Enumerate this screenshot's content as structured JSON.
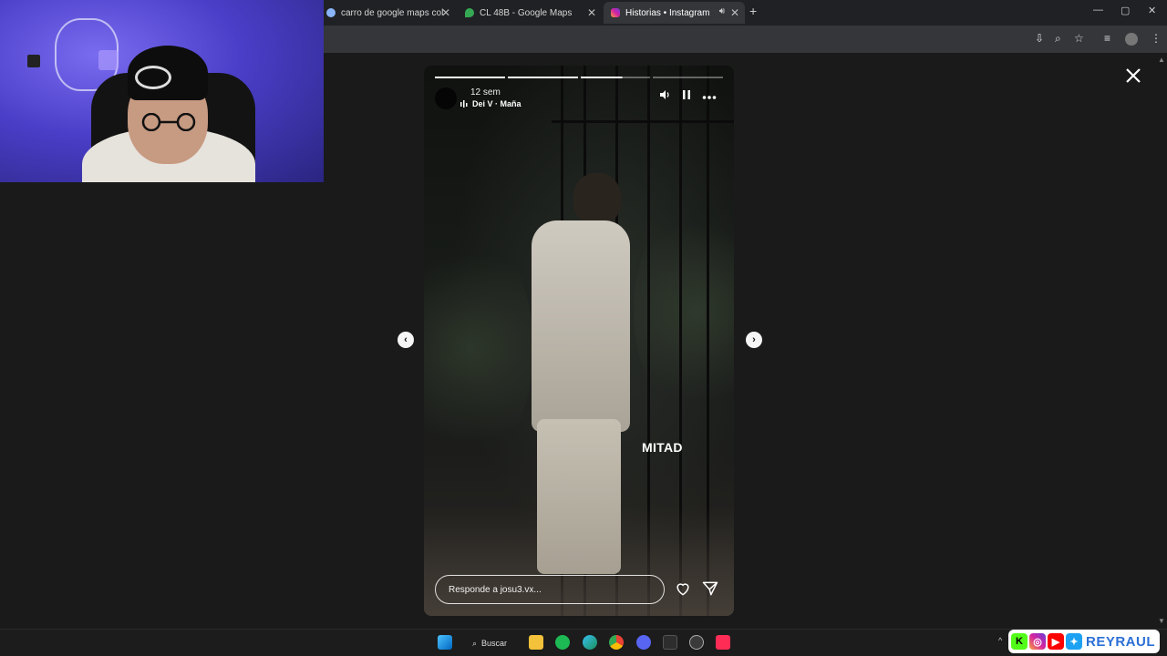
{
  "browser": {
    "tabs": [
      {
        "label": "carro de google maps colombia",
        "icon": "google-icon",
        "active": false
      },
      {
        "label": "CL 48B - Google Maps",
        "icon": "maps-pin-icon",
        "active": false
      },
      {
        "label": "Historias • Instagram",
        "icon": "instagram-icon",
        "active": true
      }
    ],
    "new_tab": "+",
    "window_controls": {
      "minimize": "—",
      "maximize": "▢",
      "close": "✕"
    }
  },
  "story": {
    "time_ago": "12 sem",
    "music": "Dei V · Maña",
    "caption": "MITAD",
    "reply_placeholder": "Responde a josu3.vx...",
    "progress": {
      "segments": 4,
      "completed": 2,
      "current_fraction": 0.6
    }
  },
  "taskbar": {
    "search_label": "Buscar",
    "apps": [
      "windows-start-icon",
      "file-explorer-icon",
      "spotify-icon",
      "edge-icon",
      "chrome-icon",
      "discord-icon",
      "terminal-icon",
      "github-icon",
      "tiktok-icon"
    ]
  },
  "streamer": {
    "name": "REYRAUL",
    "social_icons": [
      "kick-icon",
      "instagram-icon",
      "youtube-icon",
      "twitter-icon"
    ]
  },
  "colors": {
    "background": "#1a1a1a",
    "tab_active": "#35363a",
    "brand_blue": "#2b6fd6"
  }
}
